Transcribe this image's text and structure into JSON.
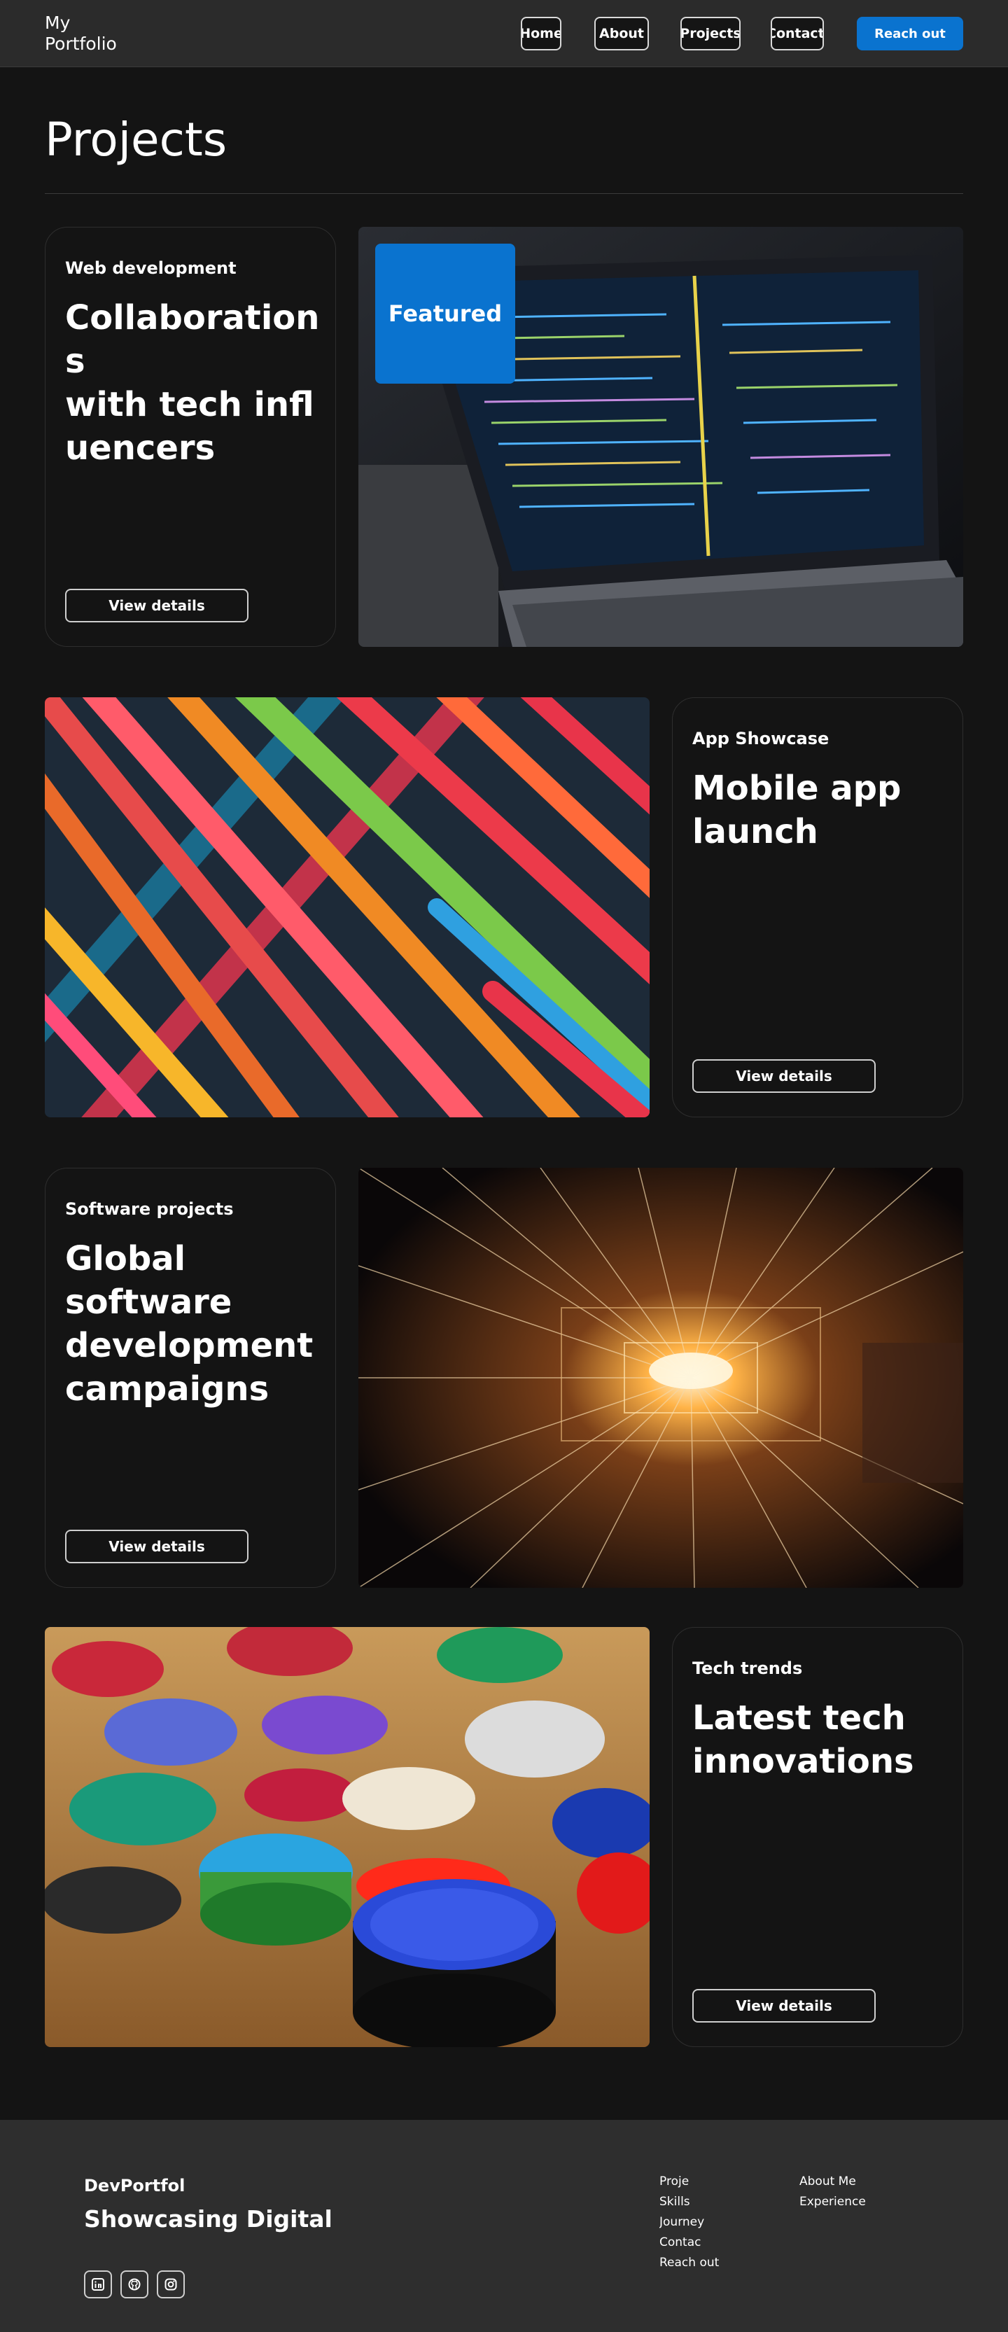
{
  "nav": {
    "brand": "My\nPortfolio",
    "links": [
      "Home",
      "About",
      "Projects",
      "Contact Me"
    ],
    "cta": "Reach out"
  },
  "page": {
    "title": "Projects"
  },
  "projects": [
    {
      "category": "Web development",
      "title": "Collaborations\nwith tech influencers",
      "button": "View details",
      "badge": "Featured"
    },
    {
      "category": "App Showcase",
      "title": "Mobile app launch",
      "button": "View details"
    },
    {
      "category": "Software projects",
      "title": "Global software development campaigns",
      "button": "View details"
    },
    {
      "category": "Tech trends",
      "title": "Latest tech innovations",
      "button": "View details"
    }
  ],
  "footer": {
    "brand": "DevPortfol",
    "tagline": "Showcasing Digital",
    "col1": [
      "Proje",
      "Skills",
      "Journey",
      "Contac",
      "Reach out"
    ],
    "col2": [
      "About Me",
      "Experience"
    ],
    "social_icons": [
      "linkedin-icon",
      "github-icon",
      "instagram-icon"
    ]
  },
  "colors": {
    "accent": "#0a73cf",
    "background": "#141414",
    "footer": "#2e2e2e"
  }
}
